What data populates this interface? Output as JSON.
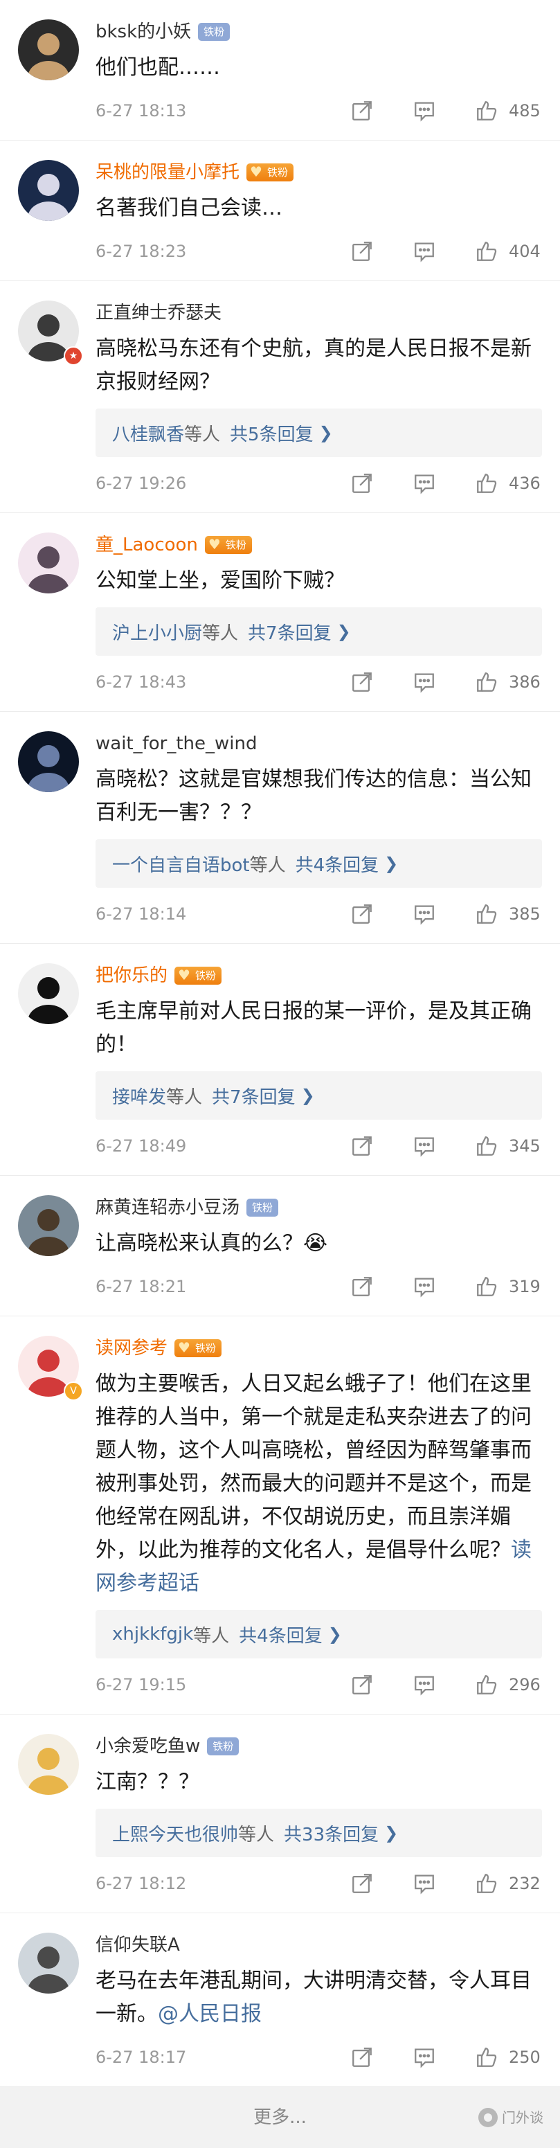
{
  "icons": {
    "repost": "repost-icon",
    "reply": "comment-icon",
    "like": "thumbs-up-icon"
  },
  "colors": {
    "vip_name": "#f06b00",
    "link": "#466e9d",
    "badge_iron": "#f08a1c",
    "badge_fan": "#8fa8d6"
  },
  "comments": [
    {
      "user": "bksk的小妖",
      "vip": false,
      "badge": "铁粉",
      "text": "他们也配……",
      "replies": null,
      "time": "6-27 18:13",
      "likes": "485"
    },
    {
      "user": "呆桃的限量小摩托",
      "vip": true,
      "badge": "铁粉",
      "text": "名著我们自己会读…",
      "replies": null,
      "time": "6-27 18:23",
      "likes": "404"
    },
    {
      "user": "正直绅士乔瑟夫",
      "vip": false,
      "badge": "",
      "text": "高晓松马东还有个史航，真的是人民日报不是新京报财经网？",
      "replies": {
        "who": "八桂飘香",
        "mid": "等人",
        "count": "共5条回复"
      },
      "time": "6-27 19:26",
      "likes": "436"
    },
    {
      "user": "童_Laocoon",
      "vip": true,
      "badge": "铁粉",
      "text": "公知堂上坐，爱国阶下贼？",
      "replies": {
        "who": "沪上小小厨",
        "mid": "等人",
        "count": "共7条回复"
      },
      "time": "6-27 18:43",
      "likes": "386"
    },
    {
      "user": "wait_for_the_wind",
      "vip": false,
      "badge": "",
      "text": "高晓松？这就是官媒想我们传达的信息：当公知百利无一害？？？",
      "replies": {
        "who": "一个自言自语bot",
        "mid": "等人",
        "count": "共4条回复"
      },
      "time": "6-27 18:14",
      "likes": "385"
    },
    {
      "user": "把你乐的",
      "vip": true,
      "badge": "铁粉",
      "text": "毛主席早前对人民日报的某一评价，是及其正确的！",
      "replies": {
        "who": "接哞发",
        "mid": "等人",
        "count": "共7条回复"
      },
      "time": "6-27 18:49",
      "likes": "345"
    },
    {
      "user": "麻黄连轺赤小豆汤",
      "vip": false,
      "badge": "铁粉",
      "text": "让高晓松来认真的么？😭",
      "replies": null,
      "time": "6-27 18:21",
      "likes": "319"
    },
    {
      "user": "读网参考",
      "vip": true,
      "badge": "铁粉",
      "text": "做为主要喉舌，人日又起幺蛾子了！他们在这里推荐的人当中，第一个就是走私夹杂进去了的问题人物，这个人叫高晓松，曾经因为醉驾肇事而被刑事处罚，然而最大的问题并不是这个，而是他经常在网乱讲，不仅胡说历史，而且崇洋媚外，以此为推荐的文化名人，是倡导什么呢？",
      "link": "读网参考超话",
      "replies": {
        "who": "xhjkkfgjk",
        "mid": "等人",
        "count": "共4条回复"
      },
      "time": "6-27 19:15",
      "likes": "296"
    },
    {
      "user": "小余爱吃鱼w",
      "vip": false,
      "badge": "铁粉",
      "text": "江南？？？",
      "replies": {
        "who": "上熙今天也很帅",
        "mid": "等人",
        "count": "共33条回复"
      },
      "time": "6-27 18:12",
      "likes": "232"
    },
    {
      "user": "信仰失联A",
      "vip": false,
      "badge": "",
      "text": "老马在去年港乱期间，大讲明清交替，令人耳目一新。",
      "link": "@人民日报",
      "replies": null,
      "time": "6-27 18:17",
      "likes": "250"
    }
  ],
  "more": {
    "label": "更多..."
  },
  "watermark": {
    "text": "门外谈"
  }
}
